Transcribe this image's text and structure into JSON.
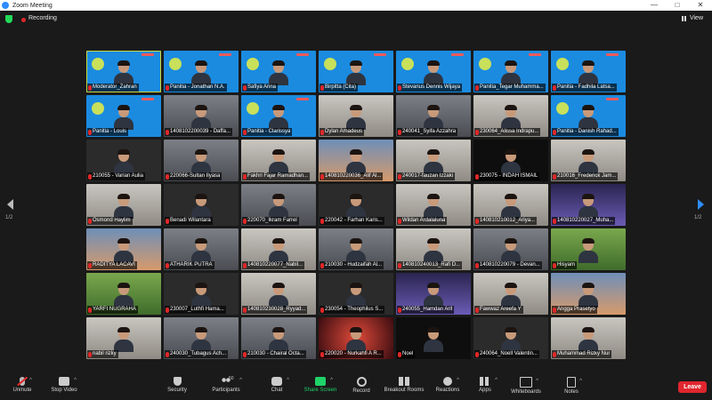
{
  "window": {
    "title": "Zoom Meeting"
  },
  "topbar": {
    "recording_label": "Recording",
    "view_label": "View"
  },
  "navigation": {
    "left_page": "1/2",
    "right_page": "1/2"
  },
  "participants": [
    {
      "name": "Moderator_Zahran",
      "bg": "blue",
      "active": true
    },
    {
      "name": "Panitia - Jonathan N.A.",
      "bg": "blue"
    },
    {
      "name": "Safiya Arina",
      "bg": "blue"
    },
    {
      "name": "Birpitta (Cita)",
      "bg": "blue"
    },
    {
      "name": "Stevanus Dennis Wijaya",
      "bg": "blue"
    },
    {
      "name": "Panitia_Tegar Muhamma...",
      "bg": "blue"
    },
    {
      "name": "Panitia - Fadhila Latsa...",
      "bg": "blue"
    },
    {
      "name": "Panitia - Louis",
      "bg": "blue"
    },
    {
      "name": "1408102200039 - Daffa...",
      "bg": "room"
    },
    {
      "name": "Panitia - Clarissya",
      "bg": "blue"
    },
    {
      "name": "Dylan Amadeus",
      "bg": "light"
    },
    {
      "name": "240041_Syifa Azzahra",
      "bg": "room"
    },
    {
      "name": "230064_Alissa Indrapu...",
      "bg": "light"
    },
    {
      "name": "Panitia - Danish Rahad...",
      "bg": "blue"
    },
    {
      "name": "210055 - Varian Aulia",
      "bg": "dark"
    },
    {
      "name": "220066-Sultan Ilyasa",
      "bg": "room"
    },
    {
      "name": "Fakhri Fajar Ramadhan...",
      "bg": "light"
    },
    {
      "name": "140810220036_Alif Al...",
      "bg": "sunset"
    },
    {
      "name": "240017-fauzan Izzaki",
      "bg": "light"
    },
    {
      "name": "230075 - INDAH ISMAIL",
      "bg": "black"
    },
    {
      "name": "210016_Frederick Jam...",
      "bg": "light"
    },
    {
      "name": "Osmond Haylim",
      "bg": "light"
    },
    {
      "name": "Benadi Wilantara",
      "bg": "dark"
    },
    {
      "name": "220070_Ikram Farrel",
      "bg": "room"
    },
    {
      "name": "220042 - Farhan Karis...",
      "bg": "dark"
    },
    {
      "name": "Wildan Ardalaluna",
      "bg": "light"
    },
    {
      "name": "140810210012_Ariya...",
      "bg": "light"
    },
    {
      "name": "140810220027_Muha...",
      "bg": "night"
    },
    {
      "name": "RADITYA LACAVI",
      "bg": "sunset"
    },
    {
      "name": "ATHARIK PUTRA",
      "bg": "room"
    },
    {
      "name": "140810220077_Nabil...",
      "bg": "light"
    },
    {
      "name": "210030 - Hudzaifah Al...",
      "bg": "room"
    },
    {
      "name": "140810240013_Rafi D...",
      "bg": "light"
    },
    {
      "name": "140810220079 - Devan...",
      "bg": "room"
    },
    {
      "name": "Hisyam",
      "bg": "green"
    },
    {
      "name": "YARFI NUGRAHA",
      "bg": "green"
    },
    {
      "name": "230007_Luthfi Hama...",
      "bg": "dark"
    },
    {
      "name": "140810230028_Ryyad...",
      "bg": "light"
    },
    {
      "name": "230054 - Theophilus S...",
      "bg": "dark"
    },
    {
      "name": "240055_Hamdan Arif",
      "bg": "night"
    },
    {
      "name": "Fawwaz Areefa Y",
      "bg": "light"
    },
    {
      "name": "Angga Prasetyo",
      "bg": "sunset"
    },
    {
      "name": "nabil rizky",
      "bg": "light"
    },
    {
      "name": "240030_Tubagus Ach...",
      "bg": "room"
    },
    {
      "name": "210030 - Chairal Octa...",
      "bg": "room"
    },
    {
      "name": "220020 - Nurkahfi A R...",
      "bg": "red"
    },
    {
      "name": "Noel",
      "bg": "black"
    },
    {
      "name": "240064_Noell Valentin...",
      "bg": "dark"
    },
    {
      "name": "Muhammad Rizky Nur",
      "bg": "light"
    }
  ],
  "toolbar": {
    "unmute": "Unmute",
    "stop_video": "Stop Video",
    "security": "Security",
    "participants": "Participants",
    "participants_count": "50",
    "chat": "Chat",
    "share_screen": "Share Screen",
    "record": "Record",
    "breakout": "Breakout Rooms",
    "reactions": "Reactions",
    "apps": "Apps",
    "whiteboards": "Whiteboards",
    "notes": "Notes",
    "leave": "Leave"
  },
  "colors": {
    "accent": "#2d8cff",
    "share": "#1fd36a",
    "leave": "#e0262e",
    "recording": "#e02828",
    "active_speaker": "#c8d93c"
  }
}
